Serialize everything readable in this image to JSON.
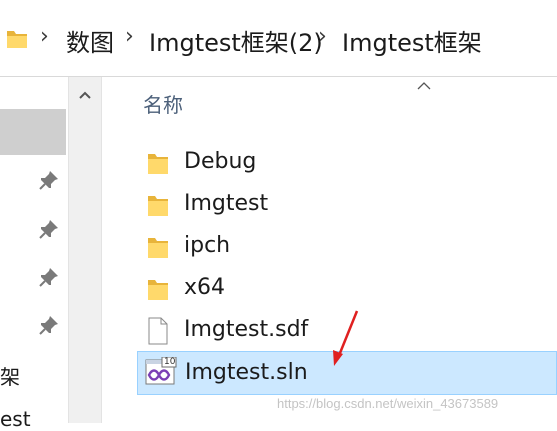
{
  "address_bar": {
    "icon": "folder-icon",
    "separator_icon": "chevron-right-icon",
    "crumbs": [
      "数图",
      "Imgtest框架(2)",
      "Imgtest框架"
    ]
  },
  "nav_pane": {
    "partial_items": [
      "架",
      "est"
    ],
    "pin_icon": "pin-icon"
  },
  "content": {
    "column_header": "名称",
    "sort_icon": "sort-ascending-caret-icon",
    "items": [
      {
        "name": "Debug",
        "icon": "folder-icon"
      },
      {
        "name": "Imgtest",
        "icon": "folder-icon"
      },
      {
        "name": "ipch",
        "icon": "folder-icon"
      },
      {
        "name": "x64",
        "icon": "folder-icon"
      },
      {
        "name": "Imgtest.sdf",
        "icon": "file-icon"
      },
      {
        "name": "Imgtest.sln",
        "icon": "visual-studio-solution-icon",
        "badge": "10",
        "selected": true
      }
    ]
  },
  "colors": {
    "selection_bg": "#cce8ff",
    "selection_border": "#99d1ff",
    "folder_yellow": "#ffd96b",
    "annotation_arrow": "#e02020"
  },
  "watermark": "https://blog.csdn.net/weixin_43673589"
}
